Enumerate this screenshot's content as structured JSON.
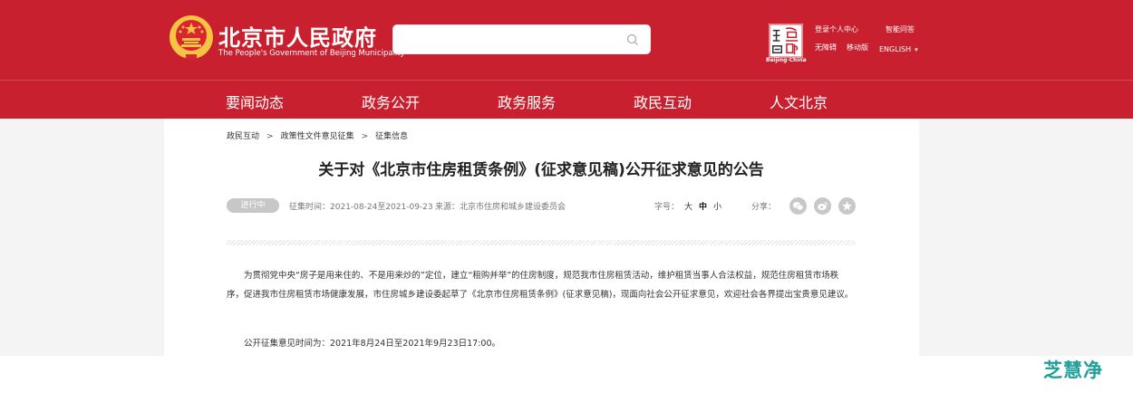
{
  "header": {
    "title": "北京市人民政府",
    "subtitle": "The People's Government of Beijing Municipality",
    "search": {
      "value": "",
      "placeholder": ""
    },
    "seal_caption": "Beijing·China",
    "links": {
      "personal_center": "登录个人中心",
      "smart_qa": "智能问答",
      "accessibility": "无障碍",
      "mobile": "移动版",
      "language": "ENGLISH"
    }
  },
  "nav": {
    "items": [
      "要闻动态",
      "政务公开",
      "政务服务",
      "政民互动",
      "人文北京"
    ]
  },
  "breadcrumb": [
    "政民互动",
    "政策性文件意见征集",
    "征集信息"
  ],
  "article": {
    "title": "关于对《北京市住房租赁条例》(征求意见稿)公开征求意见的公告",
    "status": "进行中",
    "period_label": "征集时间：",
    "period": "2021-08-24至2021-09-23",
    "source_label": "来源：",
    "source": "北京市住房和城乡建设委员会",
    "font_label": "字号：",
    "font_large": "大",
    "font_medium": "中",
    "font_small": "小",
    "share_label": "分享：",
    "paragraphs": [
      "为贯彻党中央“房子是用来住的、不是用来炒的”定位，建立“租购并举”的住房制度，规范我市住房租赁活动，维护租赁当事人合法权益，规范住房租赁市场秩序，促进我市住房租赁市场健康发展，市住房城乡建设委起草了《北京市住房租赁条例》(征求意见稿)，现面向社会公开征求意见，欢迎社会各界提出宝贵意见建议。",
      "公开征集意见时间为：2021年8月24日至2021年9月23日17:00。"
    ]
  },
  "watermark": "芝慧净",
  "colors": {
    "brand_red": "#c8202f",
    "gold": "#f6c343",
    "watermark_teal": "#1f9f9a"
  }
}
